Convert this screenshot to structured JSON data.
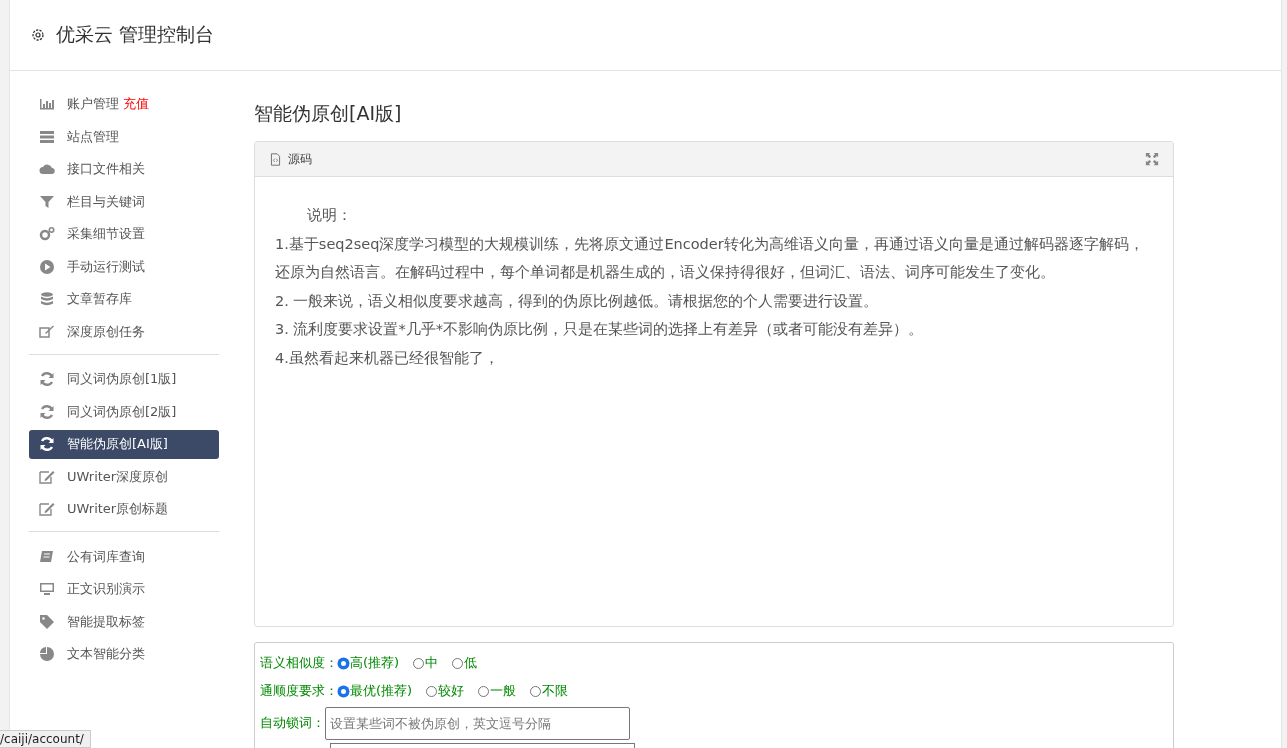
{
  "header": {
    "title": "优采云 管理控制台"
  },
  "sidebar": {
    "groups": [
      {
        "items": [
          {
            "label": "账户管理",
            "badge": "充值",
            "selected": false
          },
          {
            "label": "站点管理",
            "selected": false
          },
          {
            "label": "接口文件相关",
            "selected": false
          },
          {
            "label": "栏目与关键词",
            "selected": false
          },
          {
            "label": "采集细节设置",
            "selected": false
          },
          {
            "label": "手动运行测试",
            "selected": false
          },
          {
            "label": "文章暂存库",
            "selected": false
          },
          {
            "label": "深度原创任务",
            "selected": false
          }
        ]
      },
      {
        "items": [
          {
            "label": "同义词伪原创[1版]",
            "selected": false
          },
          {
            "label": "同义词伪原创[2版]",
            "selected": false
          },
          {
            "label": "智能伪原创[AI版]",
            "selected": true
          },
          {
            "label": "UWriter深度原创",
            "selected": false
          },
          {
            "label": "UWriter原创标题",
            "selected": false
          }
        ]
      },
      {
        "items": [
          {
            "label": "公有词库查询",
            "selected": false
          },
          {
            "label": "正文识别演示",
            "selected": false
          },
          {
            "label": "智能提取标签",
            "selected": false
          },
          {
            "label": "文本智能分类",
            "selected": false
          }
        ]
      }
    ]
  },
  "page_title": "智能伪原创[AI版]",
  "source_panel": {
    "tab": "源码",
    "heading": "说明：",
    "lines": [
      "1.基于seq2seq深度学习模型的大规模训练，先将原文通过Encoder转化为高维语义向量，再通过语义向量是通过解码器逐字解码，还原为自然语言。在解码过程中，每个单词都是机器生成的，语义保持得很好，但词汇、语法、词序可能发生了变化。",
      "2. 一般来说，语义相似度要求越高，得到的伪原比例越低。请根据您的个人需要进行设置。",
      "3. 流利度要求设置*几乎*不影响伪原比例，只是在某些词的选择上有差异（或者可能没有差异）。",
      "4.虽然看起来机器已经很智能了，"
    ]
  },
  "form": {
    "radio_rows": [
      {
        "label": "语义相似度：",
        "options": [
          {
            "label": "高(推荐)",
            "selected": true
          },
          {
            "label": "中",
            "selected": false
          },
          {
            "label": "低",
            "selected": false
          }
        ]
      },
      {
        "label": "通顺度要求：",
        "options": [
          {
            "label": "最优(推荐)",
            "selected": true
          },
          {
            "label": "较好",
            "selected": false
          },
          {
            "label": "一般",
            "selected": false
          },
          {
            "label": "不限",
            "selected": false
          }
        ]
      }
    ],
    "lock_words": {
      "label": "自动锁词：",
      "placeholder": "设置某些词不被伪原创，英文逗号分隔"
    }
  },
  "status_bar": {
    "url": "/caiji/account/"
  }
}
